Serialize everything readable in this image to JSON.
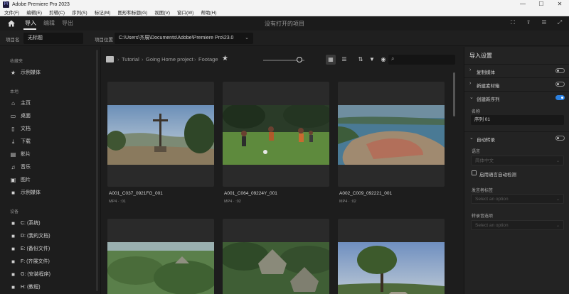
{
  "window": {
    "title": "Adobe Premiere Pro 2023",
    "app_icon": "Pr",
    "controls": [
      "—",
      "☐",
      "✕"
    ]
  },
  "menu": [
    "文件(F)",
    "编辑(E)",
    "剪辑(C)",
    "序列(S)",
    "标记(M)",
    "图形和标题(G)",
    "视图(V)",
    "窗口(W)",
    "帮助(H)"
  ],
  "header": {
    "tabs": [
      {
        "label": "导入",
        "active": true
      },
      {
        "label": "编辑",
        "active": false
      },
      {
        "label": "导出",
        "active": false
      }
    ],
    "center_title": "没有打开的项目"
  },
  "project": {
    "name_label": "项目名",
    "name_value": "无标题",
    "location_label": "项目位置",
    "location_value": "C:\\Users\\齐展\\Documents\\Adobe\\Premiere Pro\\23.0"
  },
  "sidebar": {
    "favorites_heading": "收藏夹",
    "favorites": [
      {
        "label": "示例媒体",
        "icon": "star-icon"
      }
    ],
    "local_heading": "本地",
    "local": [
      {
        "label": "主页",
        "icon": "home-icon"
      },
      {
        "label": "桌面",
        "icon": "desktop-icon"
      },
      {
        "label": "文档",
        "icon": "document-icon"
      },
      {
        "label": "下载",
        "icon": "download-icon"
      },
      {
        "label": "影片",
        "icon": "film-icon"
      },
      {
        "label": "音乐",
        "icon": "music-icon"
      },
      {
        "label": "图片",
        "icon": "image-icon"
      },
      {
        "label": "示例媒体",
        "icon": "folder-icon"
      }
    ],
    "devices_heading": "设备",
    "devices": [
      {
        "label": "C: (系统)",
        "icon": "folder-icon"
      },
      {
        "label": "D: (我的文档)",
        "icon": "folder-icon"
      },
      {
        "label": "E: (备份文件)",
        "icon": "folder-icon"
      },
      {
        "label": "F: (齐展文件)",
        "icon": "folder-icon"
      },
      {
        "label": "G: (安装程序)",
        "icon": "folder-icon"
      },
      {
        "label": "H: (教程)",
        "icon": "folder-icon"
      }
    ]
  },
  "browser": {
    "breadcrumb": [
      "Tutorial",
      "Going Home project",
      "Footage"
    ],
    "search_placeholder": "",
    "clips": [
      {
        "name": "A001_C037_0921FG_001",
        "meta": "MP4 · :01"
      },
      {
        "name": "A001_C064_09224Y_001",
        "meta": "MP4 · :02"
      },
      {
        "name": "A002_C009_092221_001",
        "meta": "MP4 · :02"
      },
      {
        "name": "",
        "meta": ""
      },
      {
        "name": "",
        "meta": ""
      },
      {
        "name": "",
        "meta": ""
      }
    ]
  },
  "import_settings": {
    "title": "导入设置",
    "copy_media": {
      "label": "复制媒体",
      "on": false
    },
    "new_bin": {
      "label": "新建素材箱",
      "on": false
    },
    "create_sequence": {
      "label": "创建新序列",
      "on": true,
      "name_label": "名称",
      "name_value": "序列 01"
    },
    "auto_transcribe": {
      "label": "自动转录",
      "on": false,
      "language_label": "语言",
      "language_value": "简体中文",
      "auto_detect_label": "启用语言自动检测",
      "speaker_label": "发言者标签",
      "speaker_placeholder": "Select an option",
      "transcribe_label": "转录音选项",
      "transcribe_placeholder": "Select an option"
    }
  },
  "colors": {
    "accent": "#2b80e0",
    "bg": "#1d1d1d",
    "panel": "#232323"
  }
}
